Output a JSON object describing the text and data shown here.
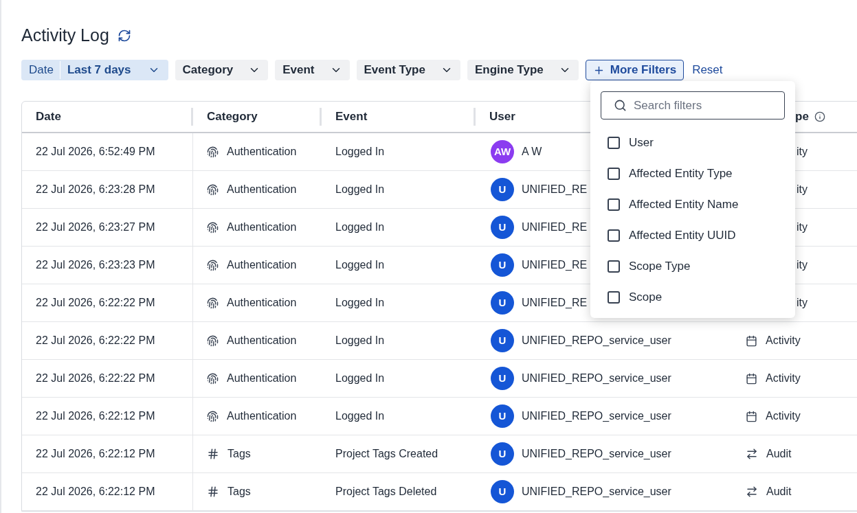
{
  "title": "Activity Log",
  "filters": [
    {
      "kind": "date",
      "label": "Date",
      "value": "Last 7 days"
    },
    {
      "kind": "dropdown",
      "label": "Category"
    },
    {
      "kind": "dropdown",
      "label": "Event"
    },
    {
      "kind": "dropdown",
      "label": "Event Type"
    },
    {
      "kind": "dropdown",
      "label": "Engine Type"
    }
  ],
  "more_filters_button": "More Filters",
  "reset_link": "Reset",
  "table": {
    "columns": [
      {
        "label": "Date"
      },
      {
        "label": "Category"
      },
      {
        "label": "Event"
      },
      {
        "label": "User"
      },
      {
        "label": "pe",
        "info": true
      }
    ],
    "rows": [
      {
        "date": "22 Jul 2026, 6:52:49 PM",
        "category": {
          "kind": "authentication",
          "text": "Authentication"
        },
        "event": "Logged In",
        "user": {
          "initials": "AW",
          "name": "A W",
          "color": "#8b3cf0"
        },
        "type": {
          "text": "ity"
        }
      },
      {
        "date": "22 Jul 2026, 6:23:28 PM",
        "category": {
          "kind": "authentication",
          "text": "Authentication"
        },
        "event": "Logged In",
        "user": {
          "initials": "U",
          "name": "UNIFIED_RE",
          "color": "#1556d6"
        },
        "type": {
          "text": "ity"
        }
      },
      {
        "date": "22 Jul 2026, 6:23:27 PM",
        "category": {
          "kind": "authentication",
          "text": "Authentication"
        },
        "event": "Logged In",
        "user": {
          "initials": "U",
          "name": "UNIFIED_RE",
          "color": "#1556d6"
        },
        "type": {
          "text": "ity"
        }
      },
      {
        "date": "22 Jul 2026, 6:23:23 PM",
        "category": {
          "kind": "authentication",
          "text": "Authentication"
        },
        "event": "Logged In",
        "user": {
          "initials": "U",
          "name": "UNIFIED_RE",
          "color": "#1556d6"
        },
        "type": {
          "text": "ity"
        }
      },
      {
        "date": "22 Jul 2026, 6:22:22 PM",
        "category": {
          "kind": "authentication",
          "text": "Authentication"
        },
        "event": "Logged In",
        "user": {
          "initials": "U",
          "name": "UNIFIED_RE",
          "color": "#1556d6"
        },
        "type": {
          "text": "ity"
        }
      },
      {
        "date": "22 Jul 2026, 6:22:22 PM",
        "category": {
          "kind": "authentication",
          "text": "Authentication"
        },
        "event": "Logged In",
        "user": {
          "initials": "U",
          "name": "UNIFIED_REPO_service_user",
          "color": "#1556d6"
        },
        "type": {
          "kind": "activity",
          "text": "Activity"
        }
      },
      {
        "date": "22 Jul 2026, 6:22:22 PM",
        "category": {
          "kind": "authentication",
          "text": "Authentication"
        },
        "event": "Logged In",
        "user": {
          "initials": "U",
          "name": "UNIFIED_REPO_service_user",
          "color": "#1556d6"
        },
        "type": {
          "kind": "activity",
          "text": "Activity"
        }
      },
      {
        "date": "22 Jul 2026, 6:22:12 PM",
        "category": {
          "kind": "authentication",
          "text": "Authentication"
        },
        "event": "Logged In",
        "user": {
          "initials": "U",
          "name": "UNIFIED_REPO_service_user",
          "color": "#1556d6"
        },
        "type": {
          "kind": "activity",
          "text": "Activity"
        }
      },
      {
        "date": "22 Jul 2026, 6:22:12 PM",
        "category": {
          "kind": "tags",
          "text": "Tags"
        },
        "event": "Project Tags Created",
        "user": {
          "initials": "U",
          "name": "UNIFIED_REPO_service_user",
          "color": "#1556d6"
        },
        "type": {
          "kind": "audit",
          "text": "Audit"
        }
      },
      {
        "date": "22 Jul 2026, 6:22:12 PM",
        "category": {
          "kind": "tags",
          "text": "Tags"
        },
        "event": "Project Tags Deleted",
        "user": {
          "initials": "U",
          "name": "UNIFIED_REPO_service_user",
          "color": "#1556d6"
        },
        "type": {
          "kind": "audit",
          "text": "Audit"
        }
      }
    ]
  },
  "filter_menu": {
    "search": {
      "placeholder": "Search filters"
    },
    "options": [
      {
        "label": "User",
        "checked": false
      },
      {
        "label": "Affected Entity Type",
        "checked": false
      },
      {
        "label": "Affected Entity Name",
        "checked": false
      },
      {
        "label": "Affected Entity UUID",
        "checked": false
      },
      {
        "label": "Scope Type",
        "checked": false
      },
      {
        "label": "Scope",
        "checked": false
      }
    ]
  }
}
